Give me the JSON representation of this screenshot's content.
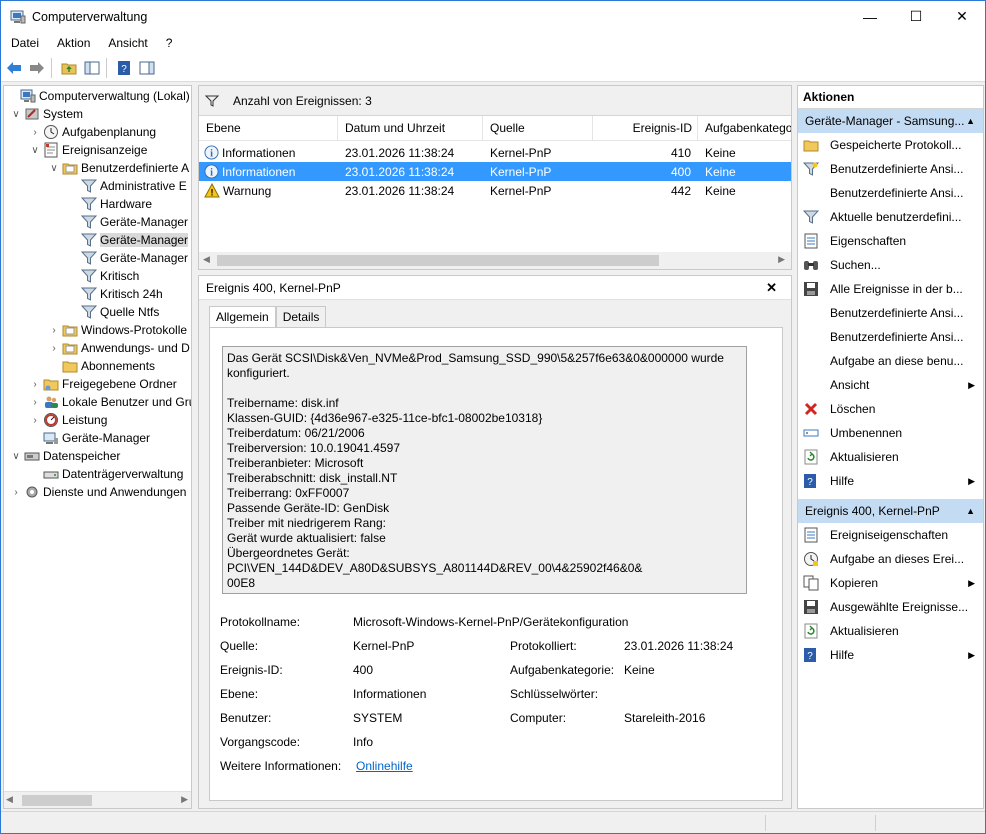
{
  "window": {
    "title": "Computerverwaltung",
    "minimize": "—",
    "maximize": "☐",
    "close": "✕"
  },
  "menu": [
    "Datei",
    "Aktion",
    "Ansicht",
    "?"
  ],
  "tree": [
    {
      "label": "Computerverwaltung (Lokal)",
      "icon": "computer-management-icon"
    },
    {
      "label": "System",
      "icon": "system-tools-icon"
    },
    {
      "label": "Aufgabenplanung",
      "icon": "task-scheduler-icon"
    },
    {
      "label": "Ereignisanzeige",
      "icon": "event-viewer-icon"
    },
    {
      "label": "Benutzerdefinierte A",
      "icon": "folder-icon"
    },
    {
      "label": "Administrative E",
      "icon": "filter-icon"
    },
    {
      "label": "Hardware",
      "icon": "filter-icon"
    },
    {
      "label": "Geräte-Manager",
      "icon": "filter-icon"
    },
    {
      "label": "Geräte-Manager",
      "icon": "filter-icon"
    },
    {
      "label": "Geräte-Manager",
      "icon": "filter-icon"
    },
    {
      "label": "Kritisch",
      "icon": "filter-icon"
    },
    {
      "label": "Kritisch 24h",
      "icon": "filter-icon"
    },
    {
      "label": "Quelle Ntfs",
      "icon": "filter-icon"
    },
    {
      "label": "Windows-Protokolle",
      "icon": "folder-icon"
    },
    {
      "label": "Anwendungs- und D",
      "icon": "folder-icon"
    },
    {
      "label": "Abonnements",
      "icon": "subscriptions-icon"
    },
    {
      "label": "Freigegebene Ordner",
      "icon": "shared-folder-icon"
    },
    {
      "label": "Lokale Benutzer und Gru",
      "icon": "users-icon"
    },
    {
      "label": "Leistung",
      "icon": "performance-icon"
    },
    {
      "label": "Geräte-Manager",
      "icon": "device-manager-icon"
    },
    {
      "label": "Datenspeicher",
      "icon": "storage-icon"
    },
    {
      "label": "Datenträgerverwaltung",
      "icon": "disk-management-icon"
    },
    {
      "label": "Dienste und Anwendungen",
      "icon": "services-icon"
    }
  ],
  "events": {
    "count_label": "Anzahl von Ereignissen: 3",
    "columns": [
      "Ebene",
      "Datum und Uhrzeit",
      "Quelle",
      "Ereignis-ID",
      "Aufgabenkatego"
    ],
    "rows": [
      {
        "level": "Informationen",
        "date": "23.01.2026 11:38:24",
        "source": "Kernel-PnP",
        "id": "410",
        "task": "Keine",
        "icon": "info-icon"
      },
      {
        "level": "Informationen",
        "date": "23.01.2026 11:38:24",
        "source": "Kernel-PnP",
        "id": "400",
        "task": "Keine",
        "icon": "info-icon"
      },
      {
        "level": "Warnung",
        "date": "23.01.2026 11:38:24",
        "source": "Kernel-PnP",
        "id": "442",
        "task": "Keine",
        "icon": "warning-icon"
      }
    ]
  },
  "detail": {
    "title": "Ereignis 400, Kernel-PnP",
    "close": "✕",
    "tabs": [
      "Allgemein",
      "Details"
    ],
    "description": "Das Gerät SCSI\\Disk&Ven_NVMe&Prod_Samsung_SSD_990\\5&257f6e63&0&000000 wurde\nkonfiguriert.\n\nTreibername: disk.inf\nKlassen-GUID: {4d36e967-e325-11ce-bfc1-08002be10318}\nTreiberdatum: 06/21/2006\nTreiberversion: 10.0.19041.4597\nTreiberanbieter: Microsoft\nTreiberabschnitt: disk_install.NT\nTreiberrang: 0xFF0007\nPassende Geräte-ID: GenDisk\nTreiber mit niedrigerem Rang:\nGerät wurde aktualisiert: false\nÜbergeordnetes Gerät: PCI\\VEN_144D&DEV_A80D&SUBSYS_A801144D&REV_00\\4&25902f46&0&\n00E8",
    "props": {
      "protokollname_label": "Protokollname:",
      "protokollname": "Microsoft-Windows-Kernel-PnP/Gerätekonfiguration",
      "quelle_label": "Quelle:",
      "quelle": "Kernel-PnP",
      "protokolliert_label": "Protokolliert:",
      "protokolliert": "23.01.2026 11:38:24",
      "ereignisid_label": "Ereignis-ID:",
      "ereignisid": "400",
      "aufgabenkat_label": "Aufgabenkategorie:",
      "aufgabenkat": "Keine",
      "ebene_label": "Ebene:",
      "ebene": "Informationen",
      "schluessel_label": "Schlüsselwörter:",
      "schluessel": "",
      "benutzer_label": "Benutzer:",
      "benutzer": "SYSTEM",
      "computer_label": "Computer:",
      "computer": "Stareleith-2016",
      "vorgang_label": "Vorgangscode:",
      "vorgang": "Info",
      "weitere_label": "Weitere Informationen:",
      "weitere_link": "Onlinehilfe"
    }
  },
  "actions": {
    "header": "Aktionen",
    "section1": "Geräte-Manager - Samsung...",
    "items1": [
      {
        "label": "Gespeicherte Protokoll...",
        "icon": "open-log-icon",
        "submenu": false
      },
      {
        "label": "Benutzerdefinierte Ansi...",
        "icon": "create-view-icon",
        "submenu": false
      },
      {
        "label": "Benutzerdefinierte Ansi...",
        "icon": "",
        "submenu": false
      },
      {
        "label": "Aktuelle benutzerdefini...",
        "icon": "filter-icon",
        "submenu": false
      },
      {
        "label": "Eigenschaften",
        "icon": "properties-icon",
        "submenu": false
      },
      {
        "label": "Suchen...",
        "icon": "find-icon",
        "submenu": false
      },
      {
        "label": "Alle Ereignisse in der b...",
        "icon": "save-icon",
        "submenu": false
      },
      {
        "label": "Benutzerdefinierte Ansi...",
        "icon": "",
        "submenu": false
      },
      {
        "label": "Benutzerdefinierte Ansi...",
        "icon": "",
        "submenu": false
      },
      {
        "label": "Aufgabe an diese benu...",
        "icon": "",
        "submenu": false
      },
      {
        "label": "Ansicht",
        "icon": "",
        "submenu": true
      },
      {
        "label": "Löschen",
        "icon": "delete-icon",
        "submenu": false
      },
      {
        "label": "Umbenennen",
        "icon": "rename-icon",
        "submenu": false
      },
      {
        "label": "Aktualisieren",
        "icon": "refresh-icon",
        "submenu": false
      },
      {
        "label": "Hilfe",
        "icon": "help-icon",
        "submenu": true
      }
    ],
    "section2": "Ereignis 400, Kernel-PnP",
    "items2": [
      {
        "label": "Ereigniseigenschaften",
        "icon": "event-properties-icon",
        "submenu": false
      },
      {
        "label": "Aufgabe an dieses Erei...",
        "icon": "attach-task-icon",
        "submenu": false
      },
      {
        "label": "Kopieren",
        "icon": "copy-icon",
        "submenu": true
      },
      {
        "label": "Ausgewählte Ereignisse...",
        "icon": "save-icon",
        "submenu": false
      },
      {
        "label": "Aktualisieren",
        "icon": "refresh-icon",
        "submenu": false
      },
      {
        "label": "Hilfe",
        "icon": "help-icon",
        "submenu": true
      }
    ],
    "arrow": "▶",
    "collapse": "▲"
  },
  "colors": {
    "accent": "#3399ff",
    "section": "#c4dcf3",
    "link": "#0066cc"
  }
}
